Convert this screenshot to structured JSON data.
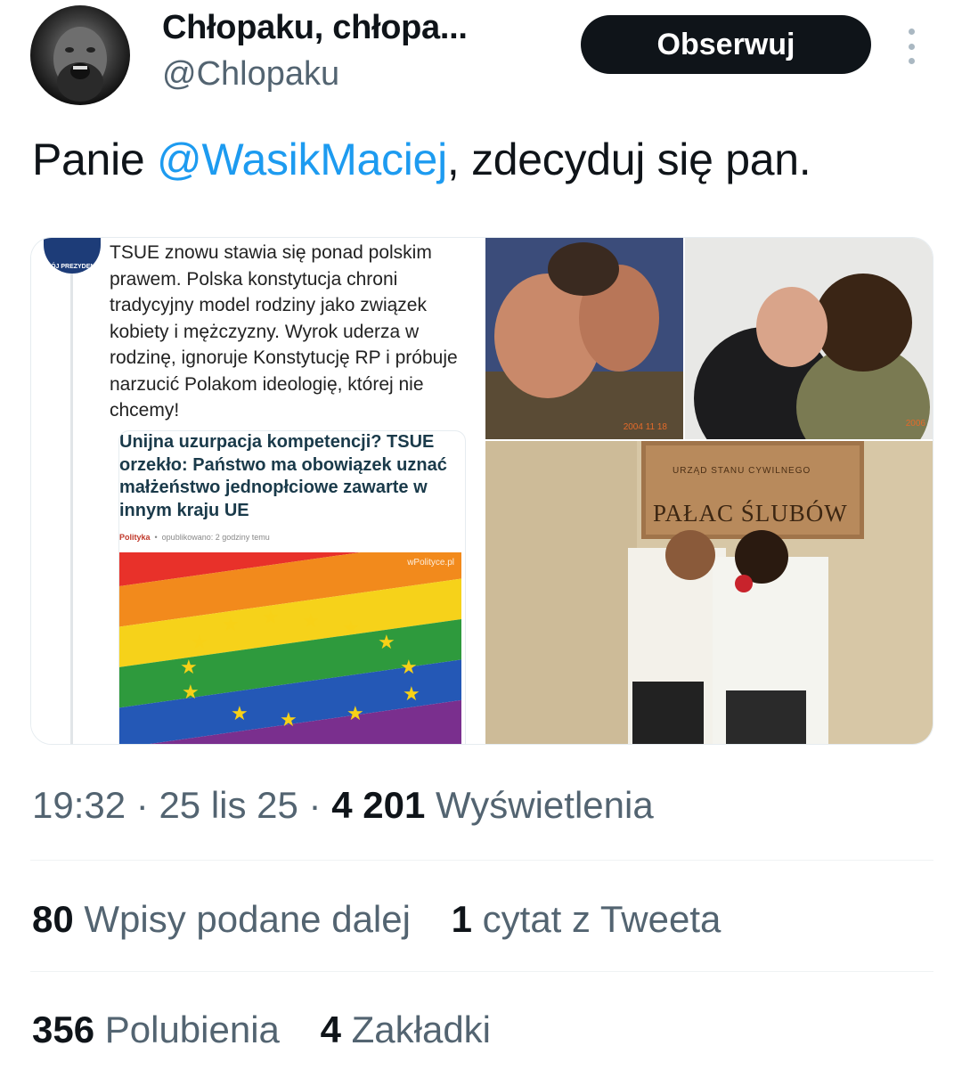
{
  "author": {
    "display_name": "Chłopaku, chłopa...",
    "handle": "@Chlopaku",
    "follow_label": "Obserwuj"
  },
  "tweet": {
    "text_before": "Panie ",
    "mention": "@WasikMaciej",
    "text_after": ", zdecyduj się pan."
  },
  "quoted": {
    "text": "TSUE znowu stawia się ponad polskim prawem. Polska konstytucja chroni tradycyjny model rodziny  jako związek kobiety i mężczyzny. Wyrok uderza w rodzinę, ignoruje Konstytucję RP i próbuje narzucić Polakom ideologię, której nie chcemy!",
    "avatar_badge": "MÓJ PREZYDENT",
    "article": {
      "title": "Unijna uzurpacja kompetencji? TSUE orzekło: Państwo ma obowiązek uznać małżeństwo jednopłciowe zawarte w innym kraju UE",
      "source": "Polityka",
      "published": "opublikowano: 2 godziny temu",
      "watermark": "wPolityce.pl"
    }
  },
  "photos": {
    "sign_text": "PAŁAC ŚLUBÓW",
    "sign_small": "URZĄD STANU CYWILNEGO",
    "date_stamp_1": "2004 11 18",
    "date_stamp_2": "2006"
  },
  "meta": {
    "time": "19:32",
    "date": "25 lis 25",
    "views_count": "4 201",
    "views_label": "Wyświetlenia"
  },
  "stats": {
    "retweets_count": "80",
    "retweets_label": "Wpisy podane dalej",
    "quotes_count": "1",
    "quotes_label": "cytat z Tweeta",
    "likes_count": "356",
    "likes_label": "Polubienia",
    "bookmarks_count": "4",
    "bookmarks_label": "Zakładki"
  },
  "colors": {
    "link": "#1d9bf0",
    "secondary_text": "#536471",
    "follow_bg": "#0f1419"
  },
  "icons": [
    "more-icon"
  ]
}
